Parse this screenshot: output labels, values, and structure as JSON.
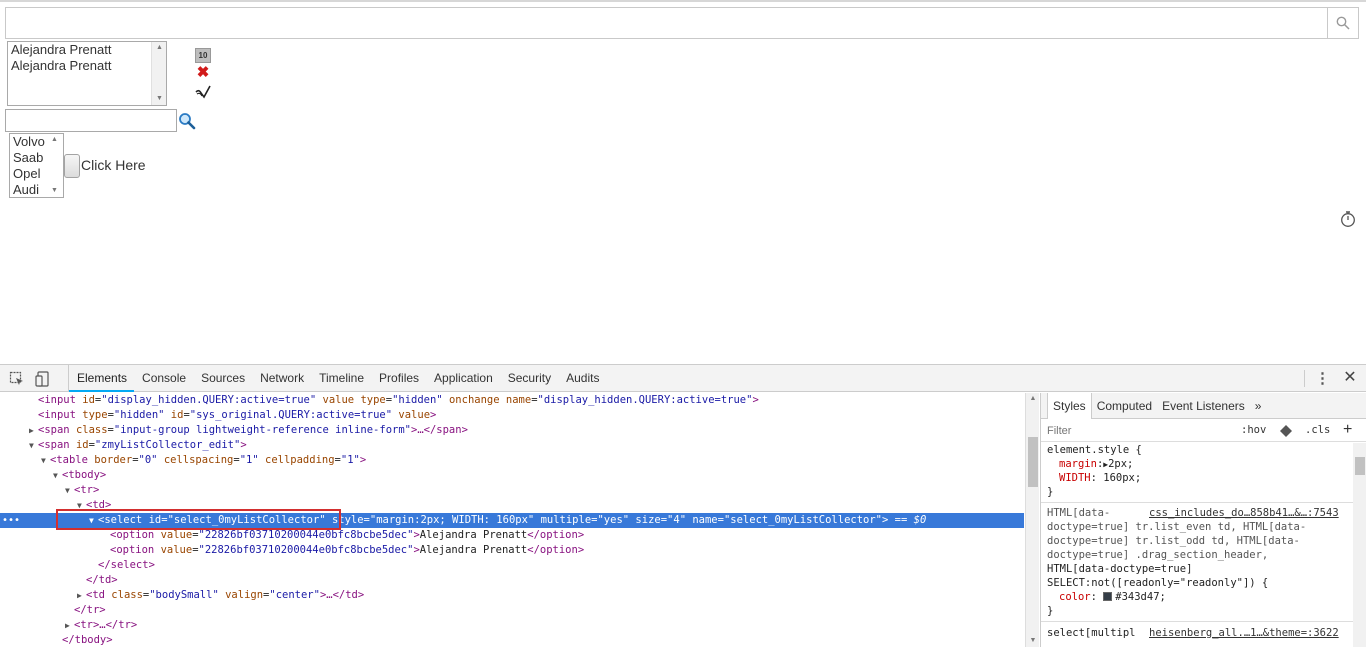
{
  "page": {
    "search": {
      "value": "",
      "placeholder": ""
    },
    "selected_list": {
      "options": [
        "Alejandra Prenatt",
        "Alejandra Prenatt"
      ]
    },
    "count_badge": "10",
    "filter": {
      "value": "",
      "placeholder": ""
    },
    "car_list": {
      "options": [
        "Volvo",
        "Saab",
        "Opel",
        "Audi"
      ]
    },
    "click_label": "Click Here"
  },
  "devtools": {
    "tabs": [
      "Elements",
      "Console",
      "Sources",
      "Network",
      "Timeline",
      "Profiles",
      "Application",
      "Security",
      "Audits"
    ],
    "active_tab": "Elements",
    "code": {
      "l0_tag_open": "<input ",
      "l0_a1": "id",
      "l0_v1": "\"display_hidden.QUERY:active=true\"",
      "l0_a2": "value",
      "l0_a3": "type",
      "l0_v3": "\"hidden\"",
      "l0_a4": "onchange",
      "l0_a5": "name",
      "l0_v5": "\"display_hidden.QUERY:active=true\"",
      "l0_tag_close": ">",
      "l1_tag_open": "<input ",
      "l1_a1": "type",
      "l1_v1": "\"hidden\"",
      "l1_a2": "id",
      "l1_v2": "\"sys_original.QUERY:active=true\"",
      "l1_a3": "value",
      "l1_tag_close": ">",
      "l2_tag_open": "<span ",
      "l2_a1": "class",
      "l2_v1": "\"input-group lightweight-reference inline-form\"",
      "l2_rest": ">…</span>",
      "l3_tag_open": "<span ",
      "l3_a1": "id",
      "l3_v1": "\"zmyListCollector_edit\"",
      "l3_tag_close": ">",
      "l4_tag_open": "<table ",
      "l4_a1": "border",
      "l4_v1": "\"0\"",
      "l4_a2": "cellspacing",
      "l4_v2": "\"1\"",
      "l4_a3": "cellpadding",
      "l4_v3": "\"1\"",
      "l4_tag_close": ">",
      "l5": "<tbody>",
      "l6": "<tr>",
      "l7": "<td>",
      "l8_tag_open": "<select ",
      "l8_a1": "id",
      "l8_v1": "\"select_0myListCollector\"",
      "l8_a2": "style",
      "l8_v2": "\"margin:2px; WIDTH: 160px\"",
      "l8_a3": "multiple",
      "l8_v3": "\"yes\"",
      "l8_a4": "size",
      "l8_v4": "\"4\"",
      "l8_a5": "name",
      "l8_v5": "\"select_0myListCollector\"",
      "l8_tag_close": ">",
      "l8_eq": " == $0",
      "l9_tag_open": "<option ",
      "l9_a1": "value",
      "l9_v1": "\"22826bf03710200044e0bfc8bcbe5dec\"",
      "l9_tag_close": ">",
      "l9_text": "Alejandra Prenatt",
      "l9_end": "</option>",
      "l10_tag_open": "<option ",
      "l10_a1": "value",
      "l10_v1": "\"22826bf03710200044e0bfc8bcbe5dec\"",
      "l10_tag_close": ">",
      "l10_text": "Alejandra Prenatt",
      "l10_end": "</option>",
      "l11": "</select>",
      "l12": "</td>",
      "l13_tag_open": "<td ",
      "l13_a1": "class",
      "l13_v1": "\"bodySmall\"",
      "l13_a2": "valign",
      "l13_v2": "\"center\"",
      "l13_rest": ">…</td>",
      "l14": "</tr>",
      "l15": "<tr>…</tr>",
      "l16": "</tbody>"
    },
    "styles": {
      "tabs": [
        "Styles",
        "Computed",
        "Event Listeners"
      ],
      "more": "»",
      "filter_placeholder": "Filter",
      "hov": ":hov",
      "cls": ".cls",
      "plus": "+",
      "rule1_selector": "element.style {",
      "rule1_p1": "margin",
      "rule1_v1": "2px;",
      "rule1_p2": "WIDTH",
      "rule1_v2": "160px;",
      "close_brace": "}",
      "rule2_sel1": "HTML[data-",
      "rule2_link": "css_includes_do…858b41…&…:7543",
      "rule2_sel2": "doctype=true] tr.list_even td, HTML[data-",
      "rule2_sel3": "doctype=true] tr.list_odd td, HTML[data-",
      "rule2_sel4": "doctype=true] .drag_section_header,",
      "rule2_sel5": "HTML[data-doctype=true]",
      "rule2_sel6": "SELECT:not([readonly=\"readonly\"]) {",
      "rule2_p1": "color",
      "rule2_v1": "#343d47;",
      "rule3_sel": "select[multipl",
      "rule3_link": "heisenberg_all.…1…&theme=:3622"
    }
  }
}
